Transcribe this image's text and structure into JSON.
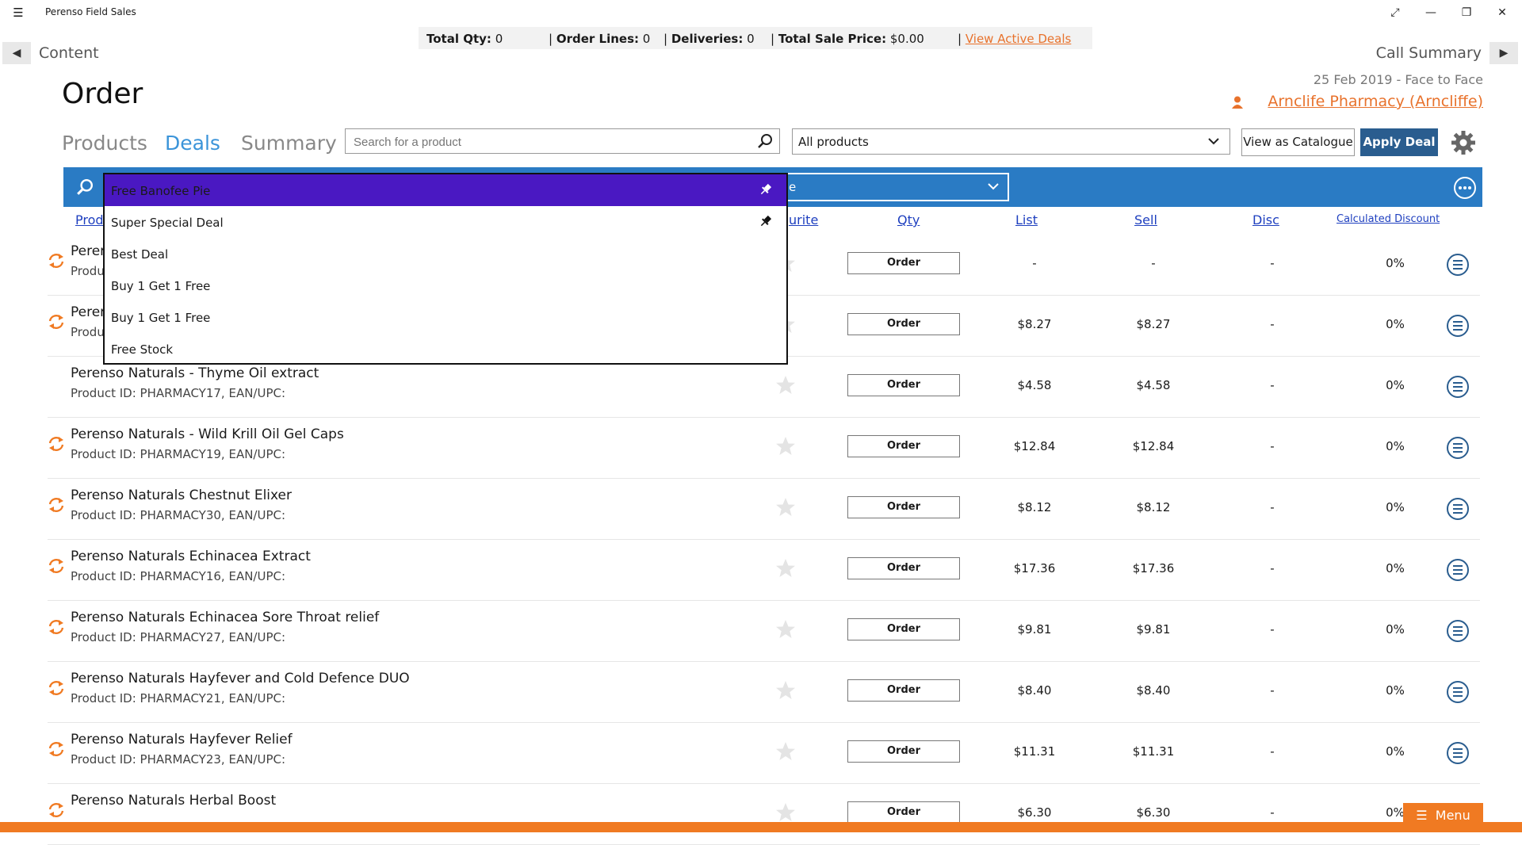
{
  "app": {
    "title": "Perenso Field Sales"
  },
  "summary": {
    "total_qty_label": "Total Qty:",
    "total_qty": "0",
    "order_lines_label": "Order Lines:",
    "order_lines": "0",
    "deliveries_label": "Deliveries:",
    "deliveries": "0",
    "total_sale_label": "Total Sale Price:",
    "total_sale": "$0.00",
    "sep": "|",
    "view_deals": "View Active Deals"
  },
  "nav": {
    "back_label": "Content",
    "forward_label": "Call Summary"
  },
  "page": {
    "title": "Order",
    "date_info": "25 Feb 2019  -  Face to Face",
    "account": "Arnclife Pharmacy (Arncliffe)"
  },
  "tabs": [
    {
      "label": "Products",
      "active": false
    },
    {
      "label": "Deals",
      "active": true
    },
    {
      "label": "Summary",
      "active": false
    }
  ],
  "search": {
    "placeholder": "Search for a product"
  },
  "filter": {
    "value": "All products"
  },
  "buttons": {
    "view_catalogue": "View as Catalogue",
    "apply_deal": "Apply Deal",
    "menu": "Menu"
  },
  "bar": {
    "select_partial": "e"
  },
  "columns": {
    "product": "Prod",
    "favourite": "urite",
    "qty": "Qty",
    "list": "List",
    "sell": "Sell",
    "disc": "Disc",
    "calc": "Calculated Discount"
  },
  "dropdown": {
    "items": [
      {
        "label": "Free Banofee Pie",
        "pinned": true,
        "selected": true
      },
      {
        "label": "Super Special Deal",
        "pinned": true,
        "selected": false
      },
      {
        "label": "Best Deal",
        "pinned": false,
        "selected": false
      },
      {
        "label": "Buy 1 Get 1 Free",
        "pinned": false,
        "selected": false
      },
      {
        "label": "Buy 1 Get 1 Free",
        "pinned": false,
        "selected": false
      },
      {
        "label": "Free Stock",
        "pinned": false,
        "selected": false
      }
    ]
  },
  "order_button_label": "Order",
  "rows": [
    {
      "name": "Perer",
      "id": "Produ",
      "list": "-",
      "sell": "-",
      "disc": "-",
      "calc": "0%",
      "sync": true
    },
    {
      "name": "Perer",
      "id": "Produ",
      "list": "$8.27",
      "sell": "$8.27",
      "disc": "-",
      "calc": "0%",
      "sync": true
    },
    {
      "name": "Perenso Naturals - Thyme Oil extract",
      "id": "Product ID: PHARMACY17, EAN/UPC:",
      "list": "$4.58",
      "sell": "$4.58",
      "disc": "-",
      "calc": "0%",
      "sync": false
    },
    {
      "name": "Perenso Naturals - Wild Krill Oil Gel Caps",
      "id": "Product ID: PHARMACY19, EAN/UPC:",
      "list": "$12.84",
      "sell": "$12.84",
      "disc": "-",
      "calc": "0%",
      "sync": true
    },
    {
      "name": "Perenso Naturals Chestnut Elixer",
      "id": "Product ID: PHARMACY30, EAN/UPC:",
      "list": "$8.12",
      "sell": "$8.12",
      "disc": "-",
      "calc": "0%",
      "sync": true
    },
    {
      "name": "Perenso Naturals Echinacea Extract",
      "id": "Product ID: PHARMACY16, EAN/UPC:",
      "list": "$17.36",
      "sell": "$17.36",
      "disc": "-",
      "calc": "0%",
      "sync": true
    },
    {
      "name": "Perenso Naturals Echinacea Sore Throat relief",
      "id": "Product ID: PHARMACY27, EAN/UPC:",
      "list": "$9.81",
      "sell": "$9.81",
      "disc": "-",
      "calc": "0%",
      "sync": true
    },
    {
      "name": "Perenso Naturals Hayfever and Cold Defence DUO",
      "id": "Product ID: PHARMACY21, EAN/UPC:",
      "list": "$8.40",
      "sell": "$8.40",
      "disc": "-",
      "calc": "0%",
      "sync": true
    },
    {
      "name": "Perenso Naturals Hayfever Relief",
      "id": "Product ID: PHARMACY23, EAN/UPC:",
      "list": "$11.31",
      "sell": "$11.31",
      "disc": "-",
      "calc": "0%",
      "sync": true
    },
    {
      "name": "Perenso Naturals Herbal Boost",
      "id": "",
      "list": "$6.30",
      "sell": "$6.30",
      "disc": "-",
      "calc": "0%",
      "sync": true
    }
  ],
  "colors": {
    "accent_orange": "#e8722c",
    "bar_blue": "#2a7bc4",
    "primary_button": "#2a5d8f",
    "dropdown_selected": "#4a18c2"
  }
}
